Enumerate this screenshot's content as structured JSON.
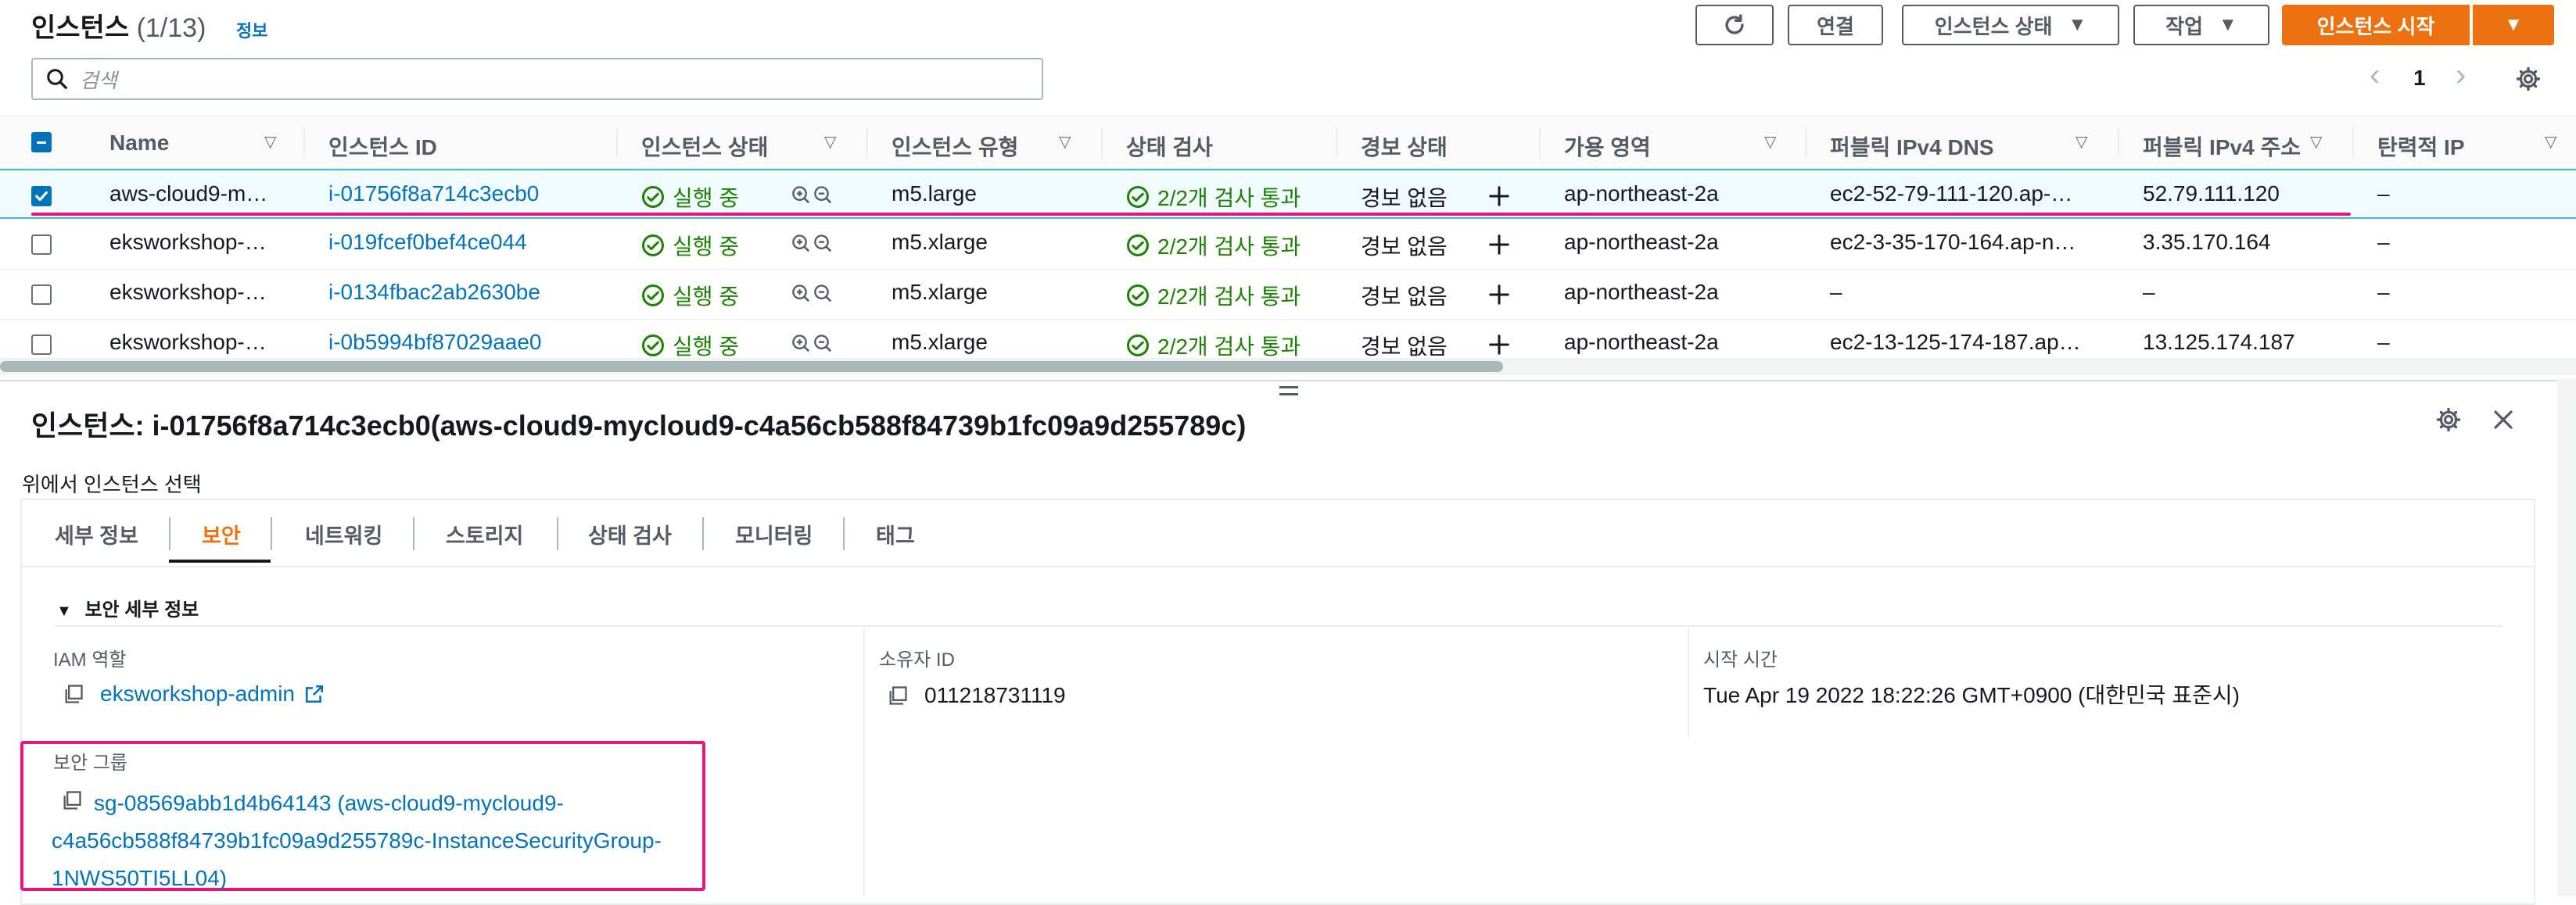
{
  "header": {
    "title": "인스턴스",
    "count": "(1/13)",
    "info": "정보",
    "refresh_icon": "refresh-icon",
    "buttons": {
      "connect": "연결",
      "instance_state": "인스턴스 상태",
      "actions": "작업",
      "launch": "인스턴스 시작"
    },
    "caret": "▼"
  },
  "search": {
    "placeholder": "검색"
  },
  "pagination": {
    "prev": "‹",
    "page": "1",
    "next": "›"
  },
  "table": {
    "columns": [
      "Name",
      "인스턴스 ID",
      "인스턴스 상태",
      "인스턴스 유형",
      "상태 검사",
      "경보 상태",
      "가용 영역",
      "퍼블릭 IPv4 DNS",
      "퍼블릭 IPv4 주소",
      "탄력적 IP"
    ],
    "rows": [
      {
        "selected": true,
        "name": "aws-cloud9-m…",
        "id": "i-01756f8a714c3ecb0",
        "state": "실행 중",
        "type": "m5.large",
        "check": "2/2개 검사 통과",
        "alarm": "경보 없음",
        "az": "ap-northeast-2a",
        "dns": "ec2-52-79-111-120.ap-…",
        "ip": "52.79.111.120",
        "eip": "–"
      },
      {
        "selected": false,
        "name": "eksworkshop-…",
        "id": "i-019fcef0bef4ce044",
        "state": "실행 중",
        "type": "m5.xlarge",
        "check": "2/2개 검사 통과",
        "alarm": "경보 없음",
        "az": "ap-northeast-2a",
        "dns": "ec2-3-35-170-164.ap-n…",
        "ip": "3.35.170.164",
        "eip": "–"
      },
      {
        "selected": false,
        "name": "eksworkshop-…",
        "id": "i-0134fbac2ab2630be",
        "state": "실행 중",
        "type": "m5.xlarge",
        "check": "2/2개 검사 통과",
        "alarm": "경보 없음",
        "az": "ap-northeast-2a",
        "dns": "–",
        "ip": "–",
        "eip": "–"
      },
      {
        "selected": false,
        "name": "eksworkshop-…",
        "id": "i-0b5994bf87029aae0",
        "state": "실행 중",
        "type": "m5.xlarge",
        "check": "2/2개 검사 통과",
        "alarm": "경보 없음",
        "az": "ap-northeast-2a",
        "dns": "ec2-13-125-174-187.ap…",
        "ip": "13.125.174.187",
        "eip": "–"
      }
    ]
  },
  "detail": {
    "title": "인스턴스: i-01756f8a714c3ecb0(aws-cloud9-mycloud9-c4a56cb588f84739b1fc09a9d255789c)",
    "subtitle": "위에서 인스턴스 선택",
    "tabs": [
      "세부 정보",
      "보안",
      "네트워킹",
      "스토리지",
      "상태 검사",
      "모니터링",
      "태그"
    ],
    "active_tab": "보안",
    "section_title": "보안 세부 정보",
    "iam_label": "IAM 역할",
    "iam_value": "eksworkshop-admin",
    "owner_label": "소유자 ID",
    "owner_value": "011218731119",
    "launch_label": "시작 시간",
    "launch_value": "Tue Apr 19 2022 18:22:26 GMT+0900 (대한민국 표준시)",
    "sg_label": "보안 그룹",
    "sg_value": "sg-08569abb1d4b64143 (aws-cloud9-mycloud9-c4a56cb588f84739b1fc09a9d255789c-InstanceSecurityGroup-1NWS50TI5LL04)"
  },
  "colors": {
    "accent": "#ec7211",
    "link": "#0073bb",
    "ok": "#1d8102",
    "highlight": "#e7157b"
  }
}
